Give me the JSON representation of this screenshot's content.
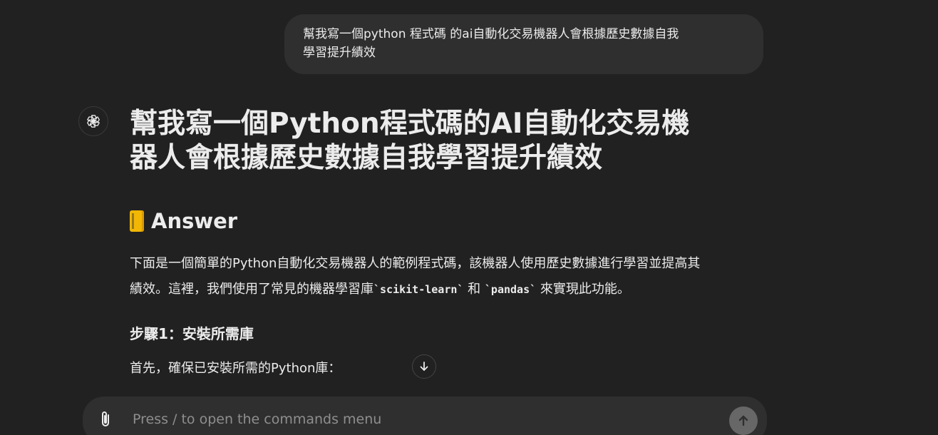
{
  "user_message": {
    "line1": "幫我寫一個python 程式碼 的ai自動化交易機器人會根據歷史數據自我",
    "line2": "學習提升績效"
  },
  "assistant": {
    "avatar_icon": "openai-logo-icon",
    "title_line1": "幫我寫一個Python程式碼的AI自動化交易機",
    "title_line2": "器人會根據歷史數據自我學習提升績效",
    "answer_heading": "Answer",
    "answer_icon": "memo-icon",
    "intro_part1": "下面是一個簡單的Python自動化交易機器人的範例程式碼，該機器人使用歷史數據進行學習並提高其",
    "intro_part2": "績效。這裡，我們使用了常見的機器學習庫",
    "code1": "`scikit-learn`",
    "intro_part3": " 和 ",
    "code2": "`pandas`",
    "intro_part4": " 來實現此功能。",
    "step1_heading": "步驟1：安裝所需庫",
    "step1_text": "首先，確保已安裝所需的Python庫："
  },
  "composer": {
    "placeholder": "Press / to open the commands menu",
    "value": ""
  },
  "colors": {
    "background": "#212121",
    "bubble": "#2f2f2f",
    "text": "#ececec",
    "placeholder": "#8e8e8e",
    "send_button": "#676767"
  }
}
